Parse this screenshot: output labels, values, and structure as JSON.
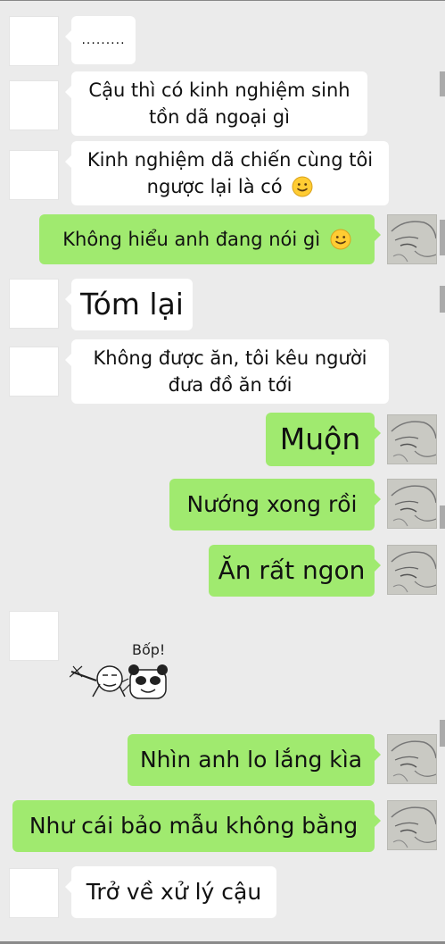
{
  "chat": {
    "messages": [
      {
        "side": "in",
        "text": "........."
      },
      {
        "side": "in",
        "text": "Cậu thì có kinh nghiệm sinh tồn dã ngoại gì"
      },
      {
        "side": "in",
        "text": "Kinh nghiệm dã chiến cùng tôi ngược lại là có",
        "emoji": "slightly-smiling-face-icon"
      },
      {
        "side": "out",
        "text": "Không hiểu anh đang nói gì",
        "emoji": "slightly-smiling-face-icon"
      },
      {
        "side": "in",
        "text": "Tóm lại"
      },
      {
        "side": "in",
        "text": "Không được ăn, tôi kêu người đưa đồ ăn tới"
      },
      {
        "side": "out",
        "text": "Muộn"
      },
      {
        "side": "out",
        "text": "Nướng xong rồi"
      },
      {
        "side": "out",
        "text": "Ăn rất ngon"
      },
      {
        "side": "in",
        "sticker": "panda-slap-sticker",
        "caption": "Bốp!"
      },
      {
        "side": "out",
        "text": "Nhìn anh lo lắng kìa"
      },
      {
        "side": "out",
        "text": "Như cái bảo mẫu không bằng"
      },
      {
        "side": "in",
        "text": "Trở về xử lý cậu"
      }
    ]
  },
  "colors": {
    "background": "#ebebeb",
    "incoming_bubble": "#ffffff",
    "outgoing_bubble": "#a0ea6f"
  }
}
